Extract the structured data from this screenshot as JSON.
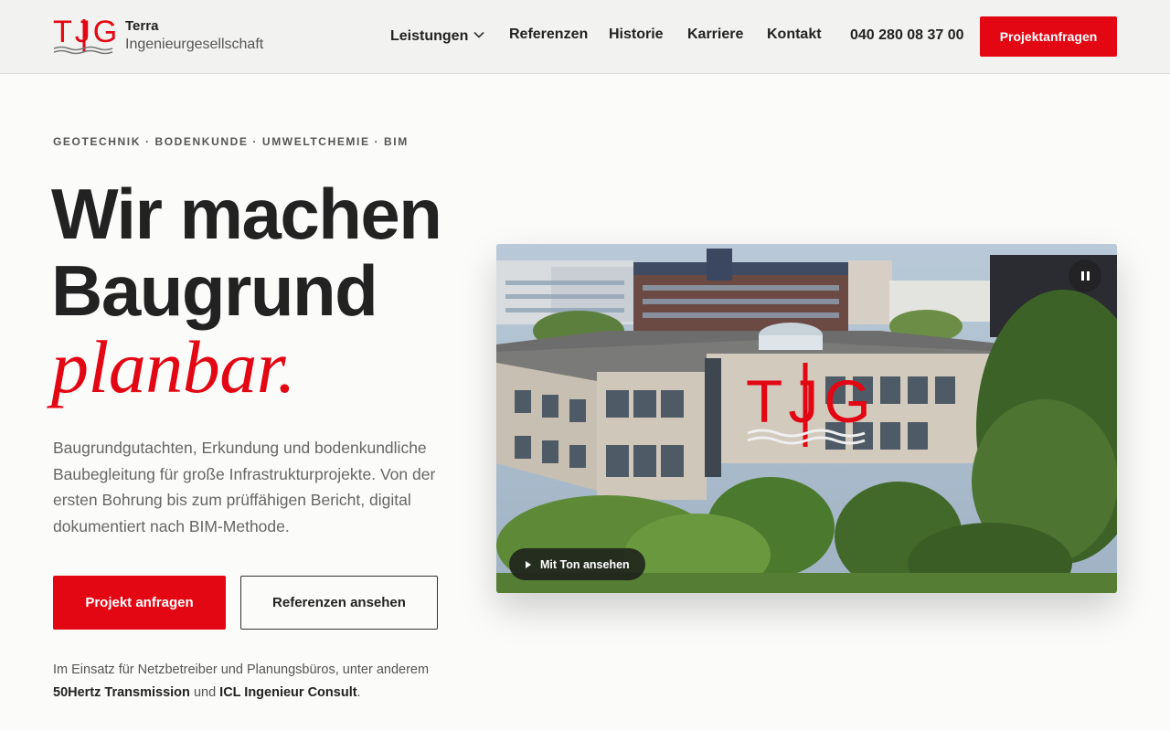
{
  "brand": {
    "logo_text": "TJG",
    "name_line1": "Terra",
    "name_line2": "Ingenieurgesellschaft",
    "accent_color": "#e30613"
  },
  "nav": {
    "items": [
      {
        "label": "Leistungen",
        "has_dropdown": true
      },
      {
        "label": "Referenzen"
      },
      {
        "label": "Historie"
      },
      {
        "label": "Karriere"
      },
      {
        "label": "Kontakt"
      }
    ],
    "phone": "040 280 08 37 00",
    "cta_label": "Projektanfragen"
  },
  "hero": {
    "eyebrow": "GEOTECHNIK · BODENKUNDE · UMWELTCHEMIE · BIM",
    "title_line1": "Wir machen",
    "title_line2": "Baugrund",
    "title_accent": "planbar.",
    "lead": "Baugrundgutachten, Erkundung und bodenkundliche Baubegleitung für große Infrastrukturprojekte. Von der ersten Bohrung bis zum prüffähigen Bericht, digital dokumentiert nach BIM-Methode.",
    "primary_button": "Projekt anfragen",
    "secondary_button": "Referenzen ansehen",
    "note_prefix": "Im Einsatz für Netzbetreiber und Planungsbüros, unter anderem",
    "note_client1": "50Hertz Transmission",
    "note_and": "und",
    "note_client2": "ICL Ingenieur Consult",
    "note_suffix": "."
  },
  "video": {
    "overlay_logo": "TJG",
    "sound_label": "Mit Ton ansehen",
    "pause_icon": "pause-icon",
    "play_icon": "play-icon"
  }
}
